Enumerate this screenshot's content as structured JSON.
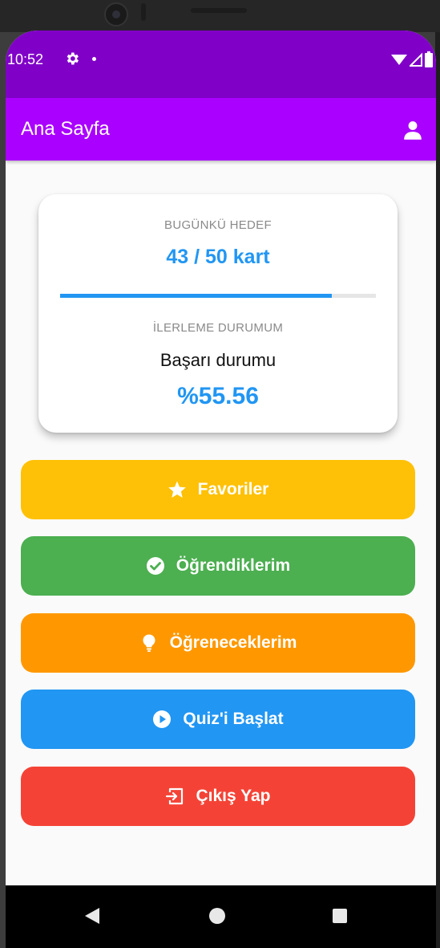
{
  "status_bar": {
    "time": "10:52",
    "icons": [
      "gear-icon",
      "notification-dot-icon",
      "wifi-icon",
      "signal-icon",
      "battery-icon"
    ]
  },
  "app_bar": {
    "title": "Ana Sayfa",
    "action_icon": "person-icon"
  },
  "goal_card": {
    "goal_label": "BUGÜNKÜ HEDEF",
    "goal_value": "43 / 50 kart",
    "goal_progress_fraction": 0.86,
    "progress_label": "İLERLEME DURUMUM",
    "success_label": "Başarı durumu",
    "success_value": "%55.56"
  },
  "menu": {
    "favorites": {
      "label": "Favoriler",
      "icon": "star-icon",
      "color": "#ffc107"
    },
    "learned": {
      "label": "Öğrendiklerim",
      "icon": "check-circle-icon",
      "color": "#4caf50"
    },
    "to_learn": {
      "label": "Öğreneceklerim",
      "icon": "lightbulb-icon",
      "color": "#ff9800"
    },
    "quiz": {
      "label": "Quiz'i Başlat",
      "icon": "play-circle-icon",
      "color": "#2196f3"
    },
    "logout": {
      "label": "Çıkış Yap",
      "icon": "logout-icon",
      "color": "#f44336"
    }
  },
  "nav_bar": {
    "icons": [
      "back-icon",
      "home-icon",
      "recents-icon"
    ]
  },
  "colors": {
    "status_bar": "#8000c8",
    "app_bar": "#aa00ff",
    "accent": "#2196f3"
  }
}
